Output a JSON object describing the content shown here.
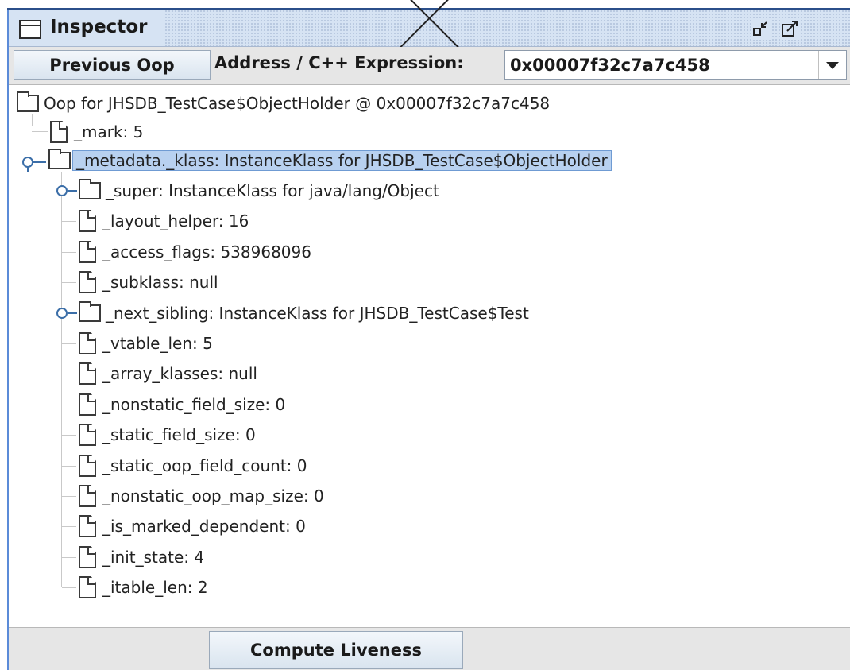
{
  "window": {
    "title": "Inspector",
    "controls": [
      "minimize-icon",
      "maximize-icon",
      "close-icon"
    ]
  },
  "toolbar": {
    "previous_label": "Previous Oop",
    "address_label": "Address / C++ Expression:",
    "address_value": "0x00007f32c7a7c458"
  },
  "tree": {
    "root": "Oop for JHSDB_TestCase$ObjectHolder @ 0x00007f32c7a7c458",
    "mark": "_mark: 5",
    "metadata": "_metadata._klass: InstanceKlass for JHSDB_TestCase$ObjectHolder",
    "children": [
      {
        "label": "_super: InstanceKlass for java/lang/Object",
        "type": "folder"
      },
      {
        "label": "_layout_helper: 16",
        "type": "file"
      },
      {
        "label": "_access_flags: 538968096",
        "type": "file"
      },
      {
        "label": "_subklass: null",
        "type": "file"
      },
      {
        "label": "_next_sibling: InstanceKlass for JHSDB_TestCase$Test",
        "type": "folder"
      },
      {
        "label": "_vtable_len: 5",
        "type": "file"
      },
      {
        "label": "_array_klasses: null",
        "type": "file"
      },
      {
        "label": "_nonstatic_field_size: 0",
        "type": "file"
      },
      {
        "label": "_static_field_size: 0",
        "type": "file"
      },
      {
        "label": "_static_oop_field_count: 0",
        "type": "file"
      },
      {
        "label": "_nonstatic_oop_map_size: 0",
        "type": "file"
      },
      {
        "label": "_is_marked_dependent: 0",
        "type": "file"
      },
      {
        "label": "_init_state: 4",
        "type": "file"
      },
      {
        "label": "_itable_len: 2",
        "type": "file"
      }
    ]
  },
  "bottom": {
    "compute_label": "Compute Liveness"
  },
  "colors": {
    "selection": "#b8d1f0",
    "title_bar": "#d6e3f3",
    "toggle": "#3b6ea8"
  }
}
